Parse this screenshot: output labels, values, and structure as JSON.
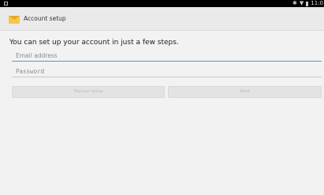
{
  "status_bar": {
    "time": "11:0"
  },
  "action_bar": {
    "title": "Account setup"
  },
  "form": {
    "heading": "You can set up your account in just a few steps.",
    "email": {
      "value": "",
      "placeholder": "Email address"
    },
    "password": {
      "value": "",
      "placeholder": "Password"
    }
  },
  "buttons": {
    "manual_setup": "Manual setup",
    "next": "Next"
  },
  "colors": {
    "accent": "#35a7d8",
    "status_bar": "#000000",
    "action_bar": "#eaeaea",
    "background": "#f2f2f2"
  }
}
